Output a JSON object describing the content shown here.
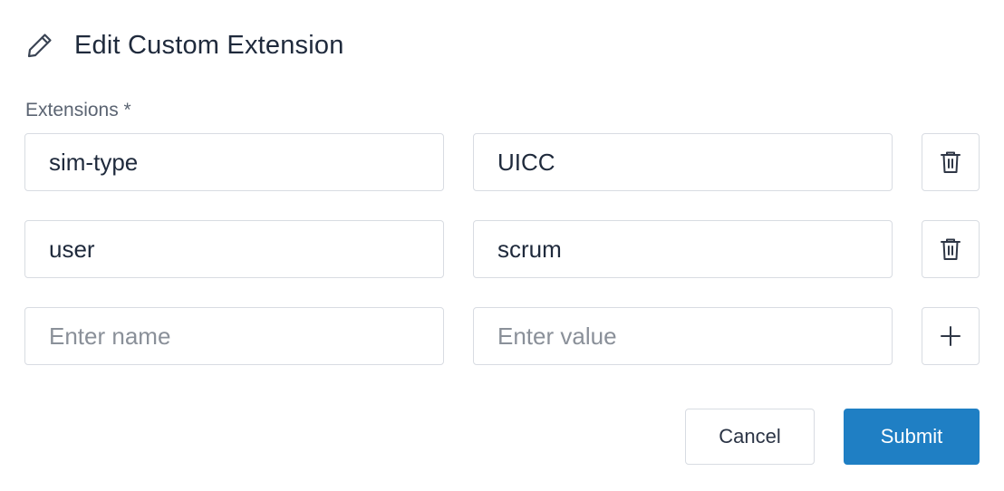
{
  "header": {
    "icon": "pencil-icon",
    "title": "Edit Custom Extension"
  },
  "form": {
    "extensions_label": "Extensions *",
    "rows": [
      {
        "name": "sim-type",
        "value": "UICC",
        "action_icon": "trash-icon"
      },
      {
        "name": "user",
        "value": "scrum",
        "action_icon": "trash-icon"
      }
    ],
    "new_row": {
      "name_placeholder": "Enter name",
      "value_placeholder": "Enter value",
      "action_icon": "plus-icon"
    }
  },
  "actions": {
    "cancel_label": "Cancel",
    "submit_label": "Submit"
  },
  "colors": {
    "primary": "#1f7fc4",
    "text": "#1f2a3c",
    "border": "#d8dce2"
  }
}
